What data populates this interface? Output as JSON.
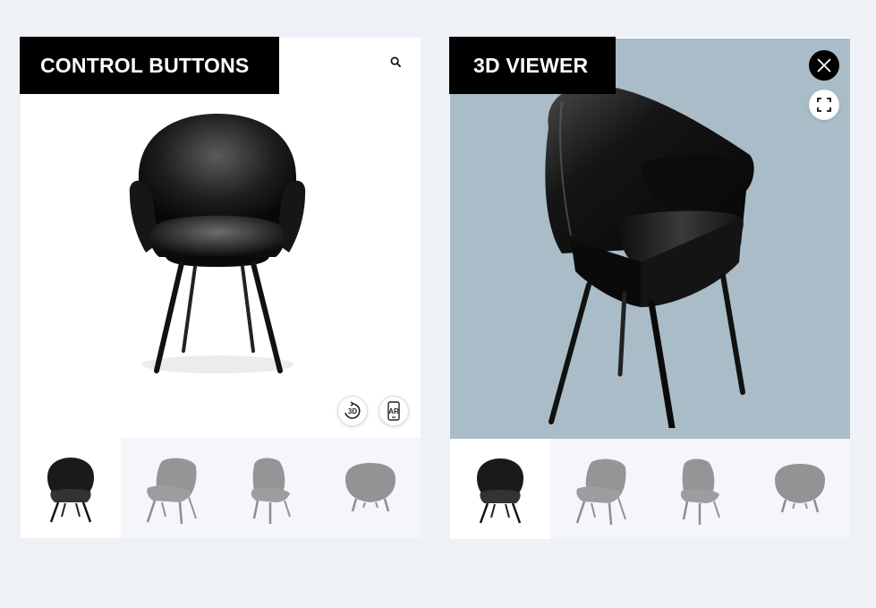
{
  "left_panel": {
    "label": "CONTROL BUTTONS",
    "zoom_icon": "magnifier-icon",
    "btn_3d_text": "3D",
    "btn_ar_text": "AR",
    "thumbnails": [
      "front",
      "side-left",
      "side-right",
      "back"
    ],
    "active_thumbnail": 0
  },
  "right_panel": {
    "label": "3D VIEWER",
    "close_icon": "close-icon",
    "fullscreen_icon": "fullscreen-icon",
    "thumbnails": [
      "front",
      "side-left",
      "side-right",
      "back"
    ],
    "active_thumbnail": 0
  },
  "colors": {
    "page_bg": "#eef2f7",
    "viewer_bg": "#a9bcc7",
    "label_bg": "#000000",
    "label_text": "#ffffff"
  }
}
